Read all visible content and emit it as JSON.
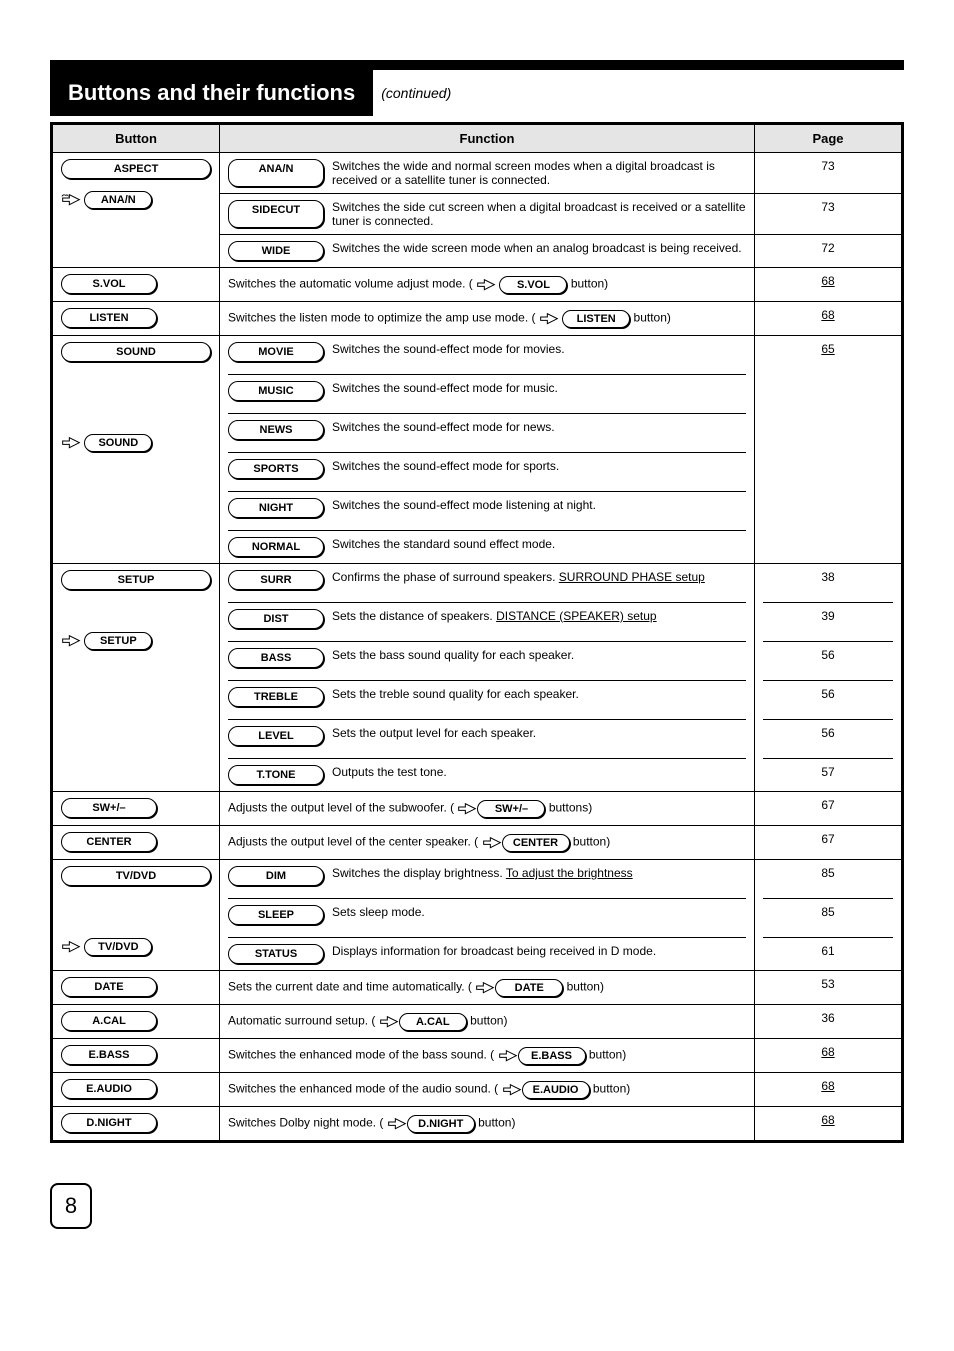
{
  "section": {
    "title": "Buttons and their functions",
    "continued": "(continued)"
  },
  "table": {
    "headers": {
      "button": "Button",
      "function": "Function",
      "page": "Page"
    }
  },
  "rows": [
    {
      "button": "ASPECT",
      "ref_btn": "ANA/N",
      "descs": [
        {
          "btn": "ANA/N",
          "text": "Switches the wide and normal screen modes when a digital broadcast is received or a satellite tuner is connected."
        },
        {
          "btn": "SIDECUT",
          "text": "Switches the side cut screen when a digital broadcast is received or a satellite tuner is connected."
        },
        {
          "btn": "WIDE",
          "text": "Switches the wide screen mode when an analog broadcast is being received."
        }
      ],
      "pages": [
        "73",
        "73",
        "72"
      ]
    },
    {
      "button": "S.VOL",
      "inline_text": "Switches the automatic volume adjust mode. (",
      "inline_ref": "S.VOL",
      "inline_tail": " button)",
      "page": "68"
    },
    {
      "button": "LISTEN",
      "inline_text": "Switches the listen mode to optimize the amp use mode. (",
      "inline_ref": "LISTEN",
      "inline_tail": " button)",
      "page": "68"
    },
    {
      "button": "SOUND",
      "ref_btn": "SOUND",
      "descs": [
        {
          "btn": "MOVIE",
          "text": "Switches the sound-effect mode for movies."
        },
        {
          "btn": "MUSIC",
          "text": "Switches the sound-effect mode for music."
        },
        {
          "btn": "NEWS",
          "text": "Switches the sound-effect mode for news."
        },
        {
          "btn": "SPORTS",
          "text": "Switches the sound-effect mode for sports."
        },
        {
          "btn": "NIGHT",
          "text": "Switches the sound-effect mode listening at night."
        },
        {
          "btn": "NORMAL",
          "text": "Switches the standard sound effect mode."
        }
      ],
      "pages": [
        "65"
      ]
    },
    {
      "button": "SETUP",
      "ref_btn": "SETUP",
      "descs": [
        {
          "btn": "SURR",
          "text": "Confirms the phase of surround speakers."
        },
        {
          "btn": "DIST",
          "text": "Sets the distance of speakers."
        },
        {
          "btn": "BASS",
          "text": "Sets the bass sound quality for each speaker."
        },
        {
          "btn": "TREBLE",
          "text": "Sets the treble sound quality for each speaker."
        },
        {
          "btn": "LEVEL",
          "text": "Sets the output level for each speaker."
        },
        {
          "btn": "T.TONE",
          "text": "Outputs the test tone."
        }
      ],
      "section_refs": [
        "SURROUND PHASE setup",
        "DISTANCE (SPEAKER) setup"
      ],
      "pages": [
        "38",
        "39",
        "56",
        "56",
        "56",
        "57"
      ]
    },
    {
      "button": "SW+/–",
      "inline_text": "Adjusts the output level of the subwoofer. (",
      "inline_ref": "SW+/–",
      "inline_tail": " buttons)",
      "page": "67"
    },
    {
      "button": "CENTER",
      "inline_text": "Adjusts the output level of the center speaker. (",
      "inline_ref": "CENTER",
      "inline_tail": " button)",
      "page": "67"
    },
    {
      "button": "TV/DVD",
      "ref_btn": "TV/DVD",
      "descs": [
        {
          "btn": "DIM",
          "text": "Switches the display brightness."
        },
        {
          "btn": "SLEEP",
          "text": "Sets sleep mode."
        },
        {
          "btn": "STATUS",
          "text": "Displays information for broadcast being received in D mode."
        }
      ],
      "section_ref": "To adjust the brightness",
      "pages": [
        "85",
        "85",
        "61"
      ]
    },
    {
      "button": "DATE",
      "inline_text": "Sets the current date and time automatically. (",
      "inline_ref": "DATE",
      "inline_tail": " button)",
      "page": "53"
    },
    {
      "button": "A.CAL",
      "inline_text": "Automatic surround setup. (",
      "inline_ref": "A.CAL",
      "inline_tail": " button)",
      "page": "36"
    },
    {
      "button": "E.BASS",
      "inline_text": "Switches the enhanced mode of the bass sound. (",
      "inline_ref": "E.BASS",
      "inline_tail": " button)",
      "page": "68"
    },
    {
      "button": "E.AUDIO",
      "inline_text": "Switches the enhanced mode of the audio sound. (",
      "inline_ref": "E.AUDIO",
      "inline_tail": " button)",
      "page": "68"
    },
    {
      "button": "D.NIGHT",
      "inline_text": "Switches Dolby night mode. (",
      "inline_ref": "D.NIGHT",
      "inline_tail": " button)",
      "page": "68"
    }
  ],
  "footer_page": "8"
}
